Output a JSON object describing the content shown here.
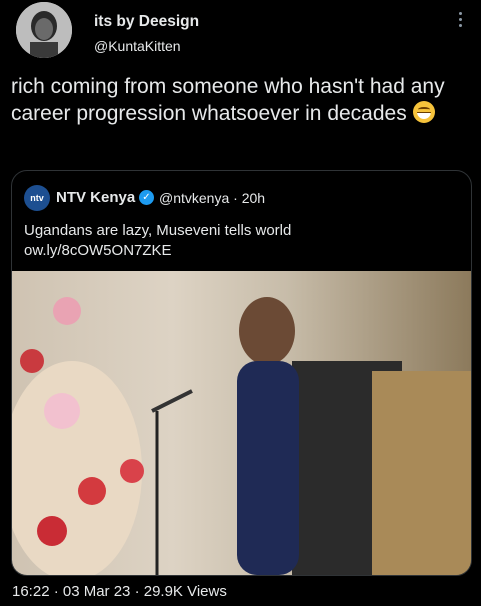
{
  "author": {
    "name": "its by Deesign",
    "handle": "@KuntaKitten"
  },
  "tweet": {
    "text": "rich coming from someone who hasn't had any career progression whatsoever in decades"
  },
  "quoted": {
    "logo": "ntv",
    "name": "NTV Kenya",
    "handle": "@ntvkenya · 20h",
    "line1": "Ugandans are lazy, Museveni tells world",
    "line2": "ow.ly/8cOW5ON7ZKE"
  },
  "meta": {
    "text": "16:22 · 03 Mar 23 · 29.9K Views"
  },
  "icons": {
    "more": "more-vertical-icon",
    "verified": "verified-badge-icon",
    "emoji": "grinning-sweat-emoji"
  },
  "colors": {
    "background": "#000000",
    "text": "#e7e9ea",
    "border": "#2f3336",
    "verified": "#1d9bf0"
  }
}
